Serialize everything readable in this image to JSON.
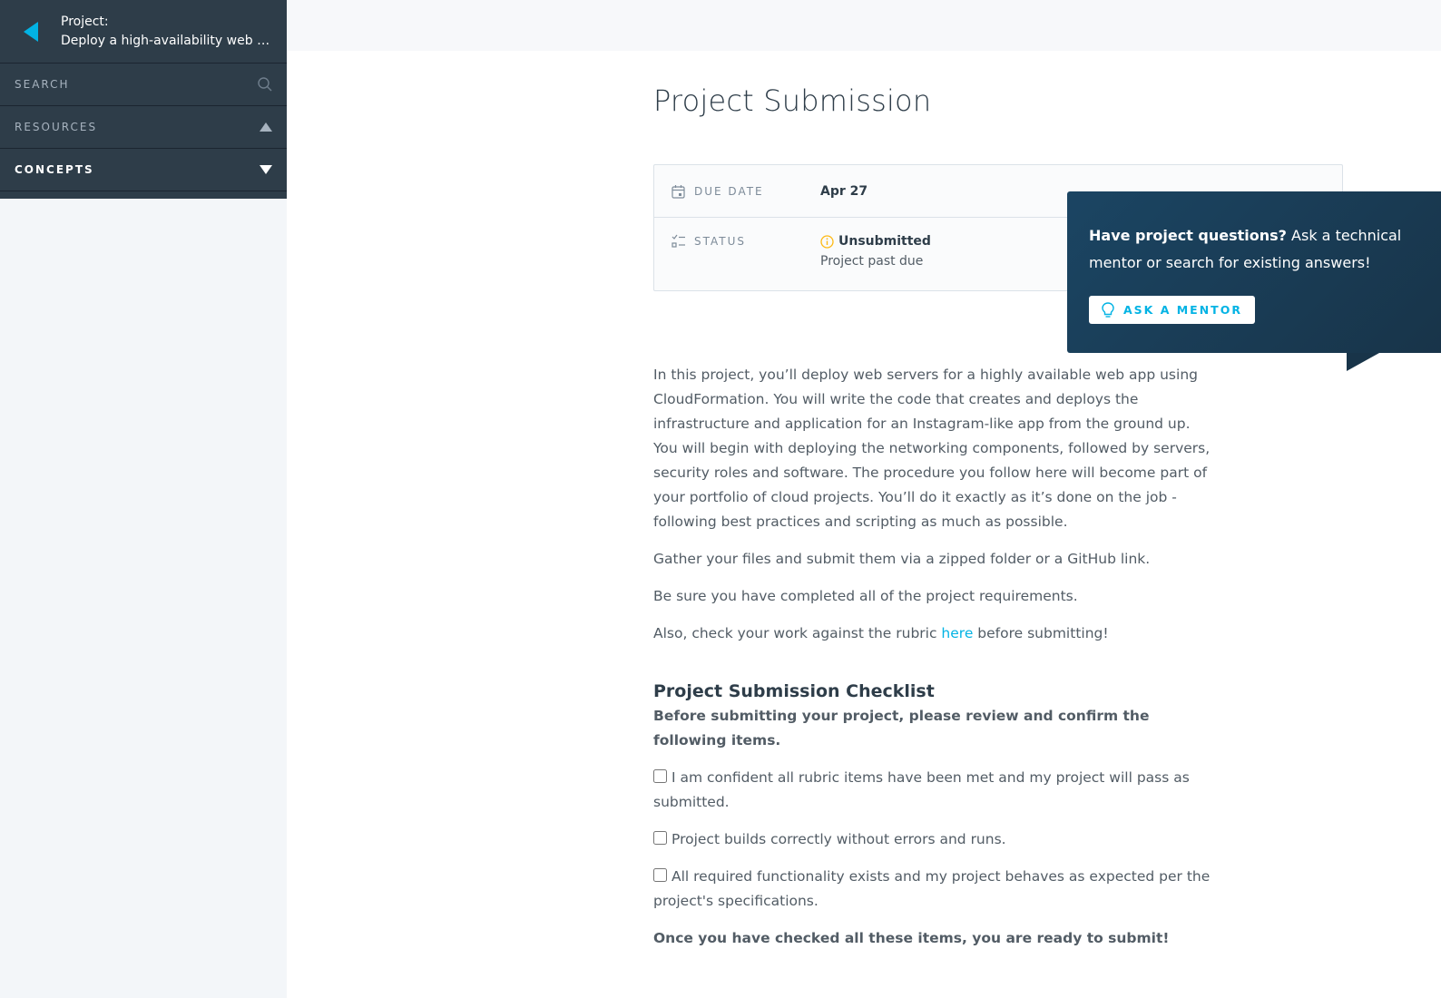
{
  "sidebar": {
    "project_label": "Project:",
    "project_name": "Deploy a high-availability web app ...",
    "search_label": "SEARCH",
    "resources_label": "RESOURCES",
    "concepts_label": "CONCEPTS"
  },
  "main": {
    "title": "Project Submission",
    "due_date_key": "DUE DATE",
    "due_date_value": "Apr 27",
    "status_key": "STATUS",
    "status_value": "Unsubmitted",
    "status_sub": "Project past due",
    "paragraphs": [
      "In this project, you’ll deploy web servers for a highly available web app using CloudFormation. You will write the code that creates and deploys the infrastructure and application for an Instagram-like app from the ground up. You will begin with deploying the networking components, followed by servers, security roles and software. The procedure you follow here will become part of your portfolio of cloud projects. You’ll do it exactly as it’s done on the job - following best practices and scripting as much as possible.",
      "Gather your files and submit them via a zipped folder or a GitHub link.",
      "Be sure you have completed all of the project requirements."
    ],
    "rubric_prefix": "Also, check your work against the rubric ",
    "rubric_link": "here",
    "rubric_suffix": " before submitting!",
    "checklist_title": "Project Submission Checklist",
    "checklist_sub": "Before submitting your project, please review and confirm the following items.",
    "checklist_items": [
      "I am confident all rubric items have been met and my project will pass as submitted.",
      "Project builds correctly without errors and runs.",
      "All required functionality exists and my project behaves as expected per the project's specifications."
    ],
    "final_note": "Once you have checked all these items, you are ready to submit!"
  },
  "mentor": {
    "bold": "Have project questions?",
    "text": " Ask a technical mentor or search for existing answers!",
    "button_label": "ASK A MENTOR"
  },
  "colors": {
    "sidebar_bg": "#2e3d49",
    "accent": "#02b3e4",
    "warning": "#fdb913",
    "popup_bg": "#1b4563"
  }
}
